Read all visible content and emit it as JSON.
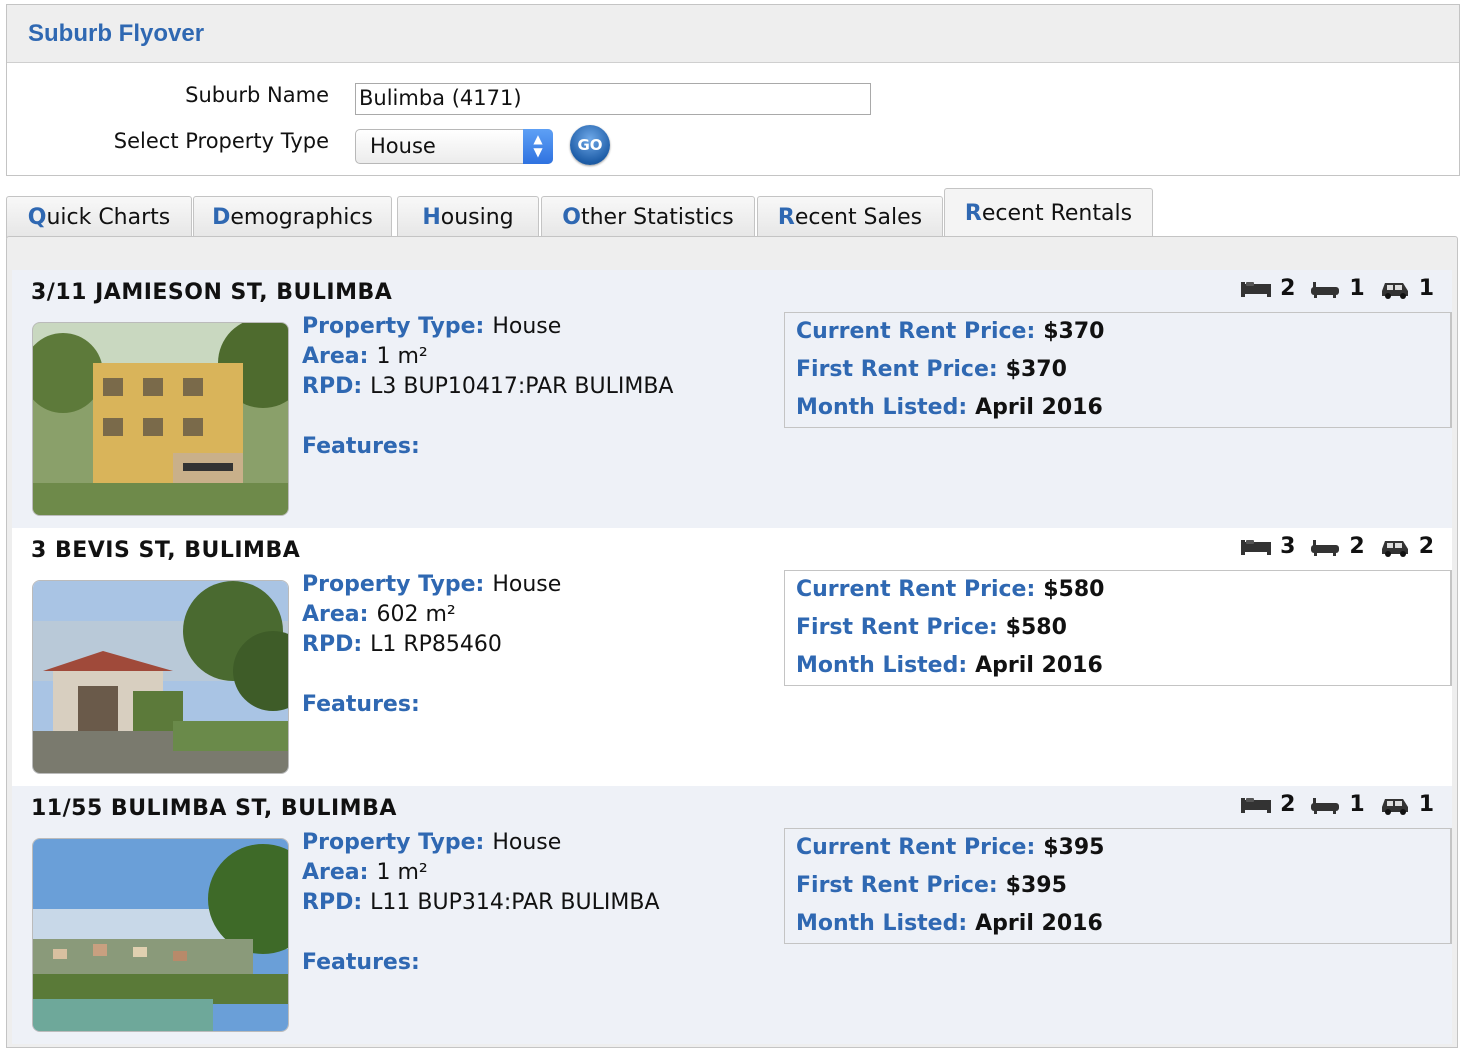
{
  "panel": {
    "title": "Suburb Flyover",
    "suburb_label": "Suburb Name",
    "suburb_value": "Bulimba (4171)",
    "type_label": "Select Property Type",
    "type_value": "House",
    "go_label": "GO"
  },
  "tabs": [
    {
      "first": "Q",
      "rest": "uick Charts"
    },
    {
      "first": "D",
      "rest": "emographics"
    },
    {
      "first": "H",
      "rest": "ousing"
    },
    {
      "first": "O",
      "rest": "ther Statistics"
    },
    {
      "first": "R",
      "rest": "ecent Sales"
    },
    {
      "first": "R",
      "rest": "ecent Rentals"
    }
  ],
  "labels": {
    "property_type": "Property Type:",
    "area": "Area:",
    "rpd": "RPD:",
    "features": "Features:",
    "current_rent": "Current Rent Price:",
    "first_rent": "First Rent Price:",
    "month_listed": "Month Listed:"
  },
  "listings": [
    {
      "address": "3/11 JAMIESON ST, BULIMBA",
      "beds": "2",
      "baths": "1",
      "cars": "1",
      "property_type": "House",
      "area": "1 m²",
      "rpd": "L3 BUP10417:PAR BULIMBA",
      "current_rent": "$370",
      "first_rent": "$370",
      "month_listed": "April 2016"
    },
    {
      "address": "3 BEVIS ST, BULIMBA",
      "beds": "3",
      "baths": "2",
      "cars": "2",
      "property_type": "House",
      "area": "602 m²",
      "rpd": "L1 RP85460",
      "current_rent": "$580",
      "first_rent": "$580",
      "month_listed": "April 2016"
    },
    {
      "address": "11/55 BULIMBA ST, BULIMBA",
      "beds": "2",
      "baths": "1",
      "cars": "1",
      "property_type": "House",
      "area": "1 m²",
      "rpd": "L11 BUP314:PAR BULIMBA",
      "current_rent": "$395",
      "first_rent": "$395",
      "month_listed": "April 2016"
    }
  ],
  "icons": {
    "bed": "bed-icon",
    "bath": "bath-icon",
    "car": "car-icon"
  },
  "colors": {
    "accent_blue": "#2f68b2",
    "listing_shade": "#eef1f7"
  }
}
